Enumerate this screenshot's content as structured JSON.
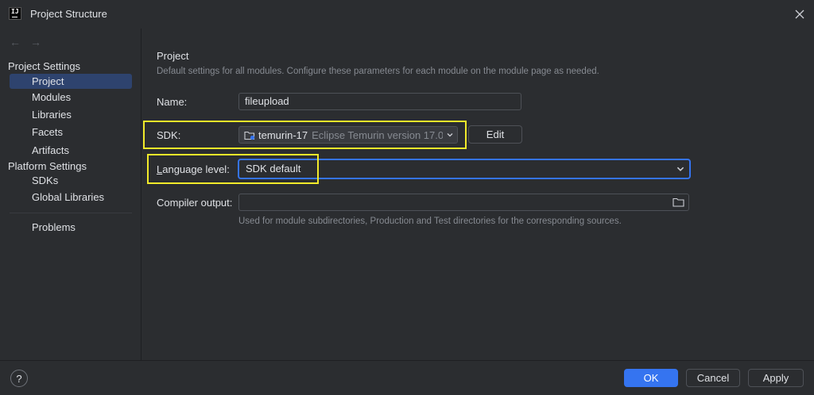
{
  "window": {
    "title": "Project Structure",
    "app_icon_text": "IJ"
  },
  "sidebar": {
    "nav_back": "←",
    "nav_forward": "→",
    "project_settings_header": "Project Settings",
    "project_settings_items": [
      {
        "label": "Project",
        "selected": true
      },
      {
        "label": "Modules"
      },
      {
        "label": "Libraries"
      },
      {
        "label": "Facets"
      },
      {
        "label": "Artifacts"
      }
    ],
    "platform_settings_header": "Platform Settings",
    "platform_settings_items": [
      {
        "label": "SDKs"
      },
      {
        "label": "Global Libraries"
      }
    ],
    "problems_label": "Problems"
  },
  "main": {
    "heading": "Project",
    "description": "Default settings for all modules. Configure these parameters for each module on the module page as needed.",
    "name_label": "Name:",
    "name_value": "fileupload",
    "sdk_label": "SDK:",
    "sdk_name": "temurin-17",
    "sdk_version": "Eclipse Temurin version 17.0",
    "edit_label": "Edit",
    "language_level_label_first": "L",
    "language_level_label_rest": "anguage level:",
    "language_level_value": "SDK default",
    "compiler_output_label": "Compiler output:",
    "compiler_output_value": "",
    "compiler_hint": "Used for module subdirectories, Production and Test directories for the corresponding sources."
  },
  "footer": {
    "help": "?",
    "ok": "OK",
    "cancel": "Cancel",
    "apply": "Apply"
  },
  "colors": {
    "accent": "#3574f0",
    "highlight": "#f1ea2a",
    "selection": "#2e436e"
  }
}
